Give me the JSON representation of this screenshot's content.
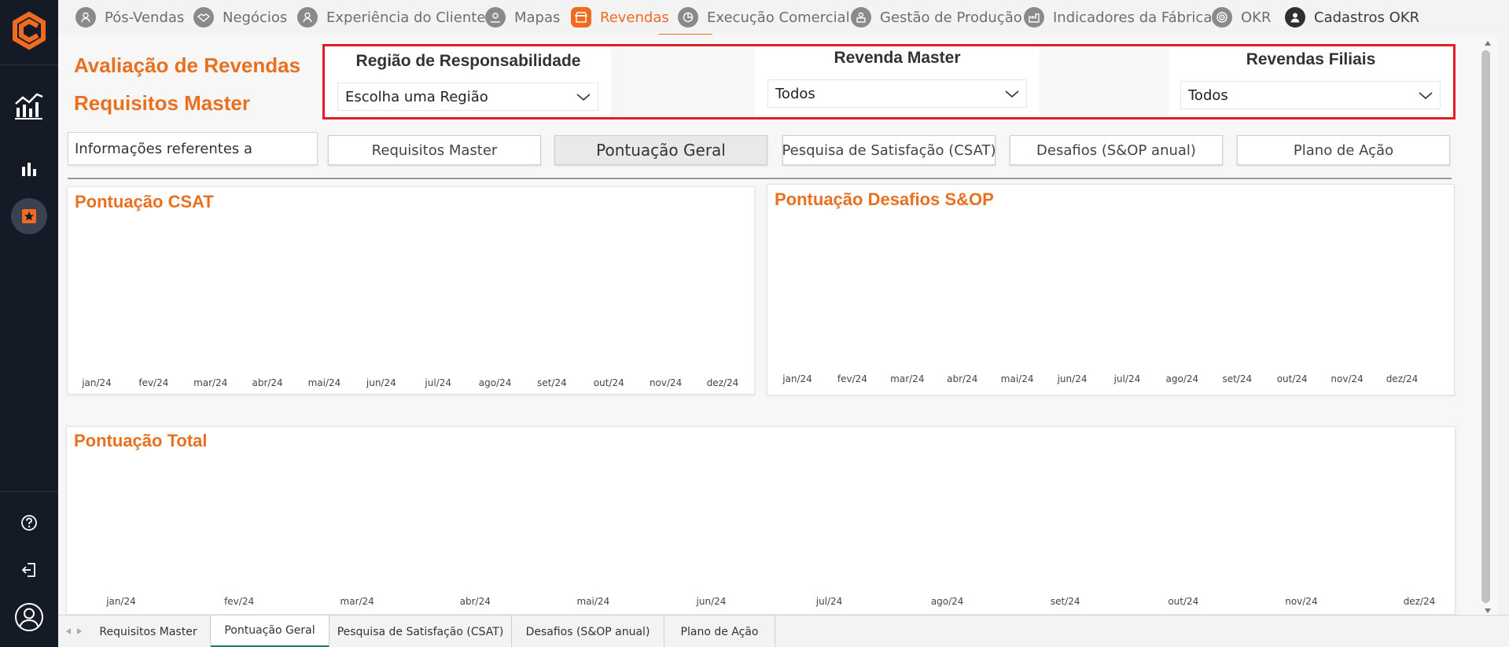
{
  "nav": {
    "items": [
      {
        "label": "Pós-Vendas",
        "icon": "person-icon"
      },
      {
        "label": "Negócios",
        "icon": "handshake-icon"
      },
      {
        "label": "Experiência do Cliente",
        "icon": "person-icon"
      },
      {
        "label": "Mapas",
        "icon": "map-person-icon"
      },
      {
        "label": "Revendas",
        "icon": "store-icon"
      },
      {
        "label": "Execução Comercial",
        "icon": "pie-chart-icon"
      },
      {
        "label": "Gestão de Produção",
        "icon": "factory-person-icon"
      },
      {
        "label": "Indicadores da Fábrica",
        "icon": "factory-icon"
      },
      {
        "label": "OKR",
        "icon": "target-icon"
      },
      {
        "label": "Cadastros OKR",
        "icon": "user-icon"
      }
    ],
    "active_index": 4
  },
  "report": {
    "title_line1": "Avaliação de Revendas",
    "title_line2": "Requisitos Master"
  },
  "filters": {
    "regiao": {
      "title": "Região de Responsabilidade",
      "value": "Escolha uma Região"
    },
    "master": {
      "title": "Revenda Master",
      "value": "Todos"
    },
    "filiais": {
      "title": "Revendas Filiais",
      "value": "Todos"
    }
  },
  "info_label": "Informações referentes a",
  "page_buttons": [
    "Requisitos Master",
    "Pontuação Geral",
    "Pesquisa de Satisfação (CSAT)",
    "Desafios (S&OP anual)",
    "Plano de Ação"
  ],
  "active_page_button": 1,
  "charts": {
    "csat": {
      "title": "Pontuação CSAT"
    },
    "sop": {
      "title": "Pontuação Desafios S&OP"
    },
    "total": {
      "title": "Pontuação Total"
    }
  },
  "chart_data": [
    {
      "type": "line",
      "title": "Pontuação CSAT",
      "categories": [
        "jan/24",
        "fev/24",
        "mar/24",
        "abr/24",
        "mai/24",
        "jun/24",
        "jul/24",
        "ago/24",
        "set/24",
        "out/24",
        "nov/24",
        "dez/24"
      ],
      "series": []
    },
    {
      "type": "line",
      "title": "Pontuação Desafios S&OP",
      "categories": [
        "jan/24",
        "fev/24",
        "mar/24",
        "abr/24",
        "mai/24",
        "jun/24",
        "jul/24",
        "ago/24",
        "set/24",
        "out/24",
        "nov/24",
        "dez/24"
      ],
      "series": []
    },
    {
      "type": "line",
      "title": "Pontuação Total",
      "categories": [
        "jan/24",
        "fev/24",
        "mar/24",
        "abr/24",
        "mai/24",
        "jun/24",
        "jul/24",
        "ago/24",
        "set/24",
        "out/24",
        "nov/24",
        "dez/24"
      ],
      "series": []
    }
  ],
  "tabs": [
    "Requisitos Master",
    "Pontuação Geral",
    "Pesquisa de Satisfação (CSAT)",
    "Desafios (S&OP anual)",
    "Plano de Ação"
  ],
  "active_tab": 1,
  "colors": {
    "accent": "#f06a1f",
    "sidebar": "#141b26",
    "highlight": "#e01e26",
    "tab_active": "#1a7f5a"
  }
}
